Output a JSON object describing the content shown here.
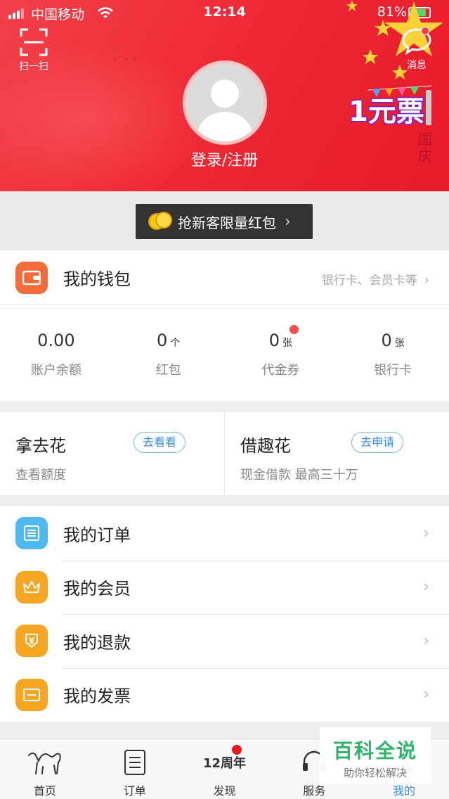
{
  "status_bar": {
    "carrier": "中国移动",
    "time": "12:14",
    "battery": "81%"
  },
  "header": {
    "scan_label": "扫一扫",
    "message_label": "消息",
    "login_label": "登录/注册",
    "promo_badge": "1元票",
    "decor_text": "国庆"
  },
  "new_customer_button": "抢新客限量红包",
  "wallet": {
    "title": "我的钱包",
    "hint": "银行卡、会员卡等",
    "stats": [
      {
        "value": "0.00",
        "unit": "",
        "label": "账户余额"
      },
      {
        "value": "0",
        "unit": "个",
        "label": "红包"
      },
      {
        "value": "0",
        "unit": "张",
        "label": "代金券"
      },
      {
        "value": "0",
        "unit": "张",
        "label": "银行卡"
      }
    ]
  },
  "credit": [
    {
      "name": "拿去花",
      "desc": "查看额度",
      "action": "去看看"
    },
    {
      "name": "借趣花",
      "desc": "现金借款 最高三十万",
      "action": "去申请"
    }
  ],
  "menu": [
    {
      "label": "我的订单",
      "icon": "order-list-icon",
      "color": "#4fb8f0"
    },
    {
      "label": "我的会员",
      "icon": "crown-icon",
      "color": "#f5a623"
    },
    {
      "label": "我的退款",
      "icon": "refund-icon",
      "color": "#f5a623"
    },
    {
      "label": "我的发票",
      "icon": "invoice-icon",
      "color": "#f5a623"
    }
  ],
  "tabbar": [
    {
      "label": "首页",
      "icon": "camel-icon"
    },
    {
      "label": "订单",
      "icon": "order-icon"
    },
    {
      "label": "发现",
      "icon": "anniversary-icon",
      "badge_text": "12周年"
    },
    {
      "label": "服务",
      "icon": "headset-icon"
    },
    {
      "label": "我的",
      "icon": "profile-icon",
      "active": true
    }
  ],
  "watermark": {
    "title": "百科全说",
    "subtitle": "助你轻松解决"
  },
  "colors": {
    "hero_red": "#ef2a36",
    "accent_blue": "#3a8ee0",
    "wallet_orange": "#f26b3a"
  }
}
